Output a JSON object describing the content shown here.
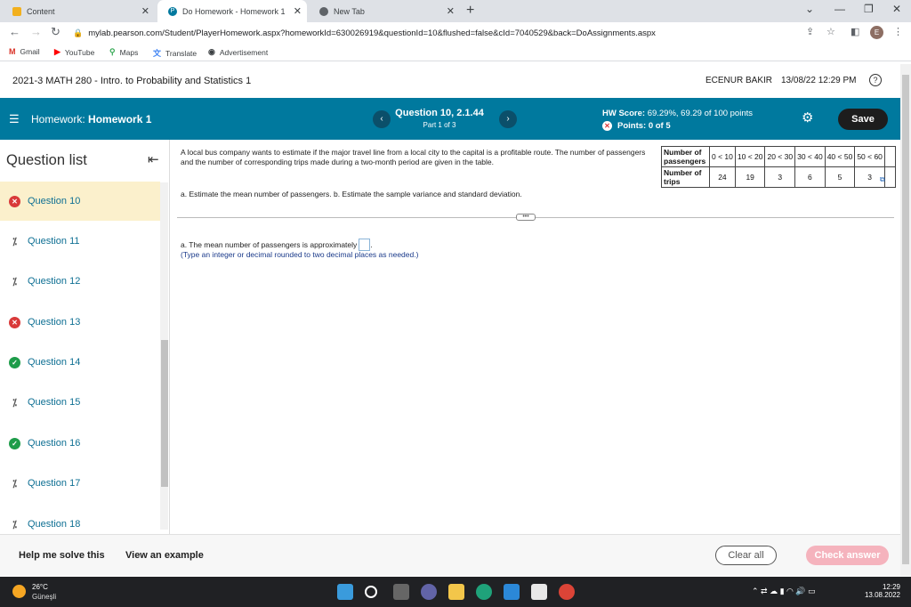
{
  "browser": {
    "tabs": [
      {
        "label": "Content",
        "active": false
      },
      {
        "label": "Do Homework - Homework 1",
        "active": true
      },
      {
        "label": "New Tab",
        "active": false
      }
    ],
    "url": "mylab.pearson.com/Student/PlayerHomework.aspx?homeworkId=630026919&questionId=10&flushed=false&cId=7040529&back=DoAssignments.aspx",
    "avatar_letter": "E",
    "bookmarks": [
      "Gmail",
      "YouTube",
      "Maps",
      "Translate",
      "Advertisement"
    ]
  },
  "course": {
    "title": "2021-3 MATH 280 - Intro. to Probability and Statistics 1",
    "user": "ECENUR BAKIR",
    "datetime": "13/08/22 12:29 PM",
    "help": "?"
  },
  "hwbar": {
    "label_prefix": "Homework:",
    "homework_name": "Homework 1",
    "question_title": "Question 10, 2.1.44",
    "part": "Part 1 of 3",
    "hw_score_label": "HW Score:",
    "hw_score_value": "69.29%, 69.29 of 100 points",
    "points": "Points: 0 of 5",
    "save_label": "Save",
    "accent": "#00799e"
  },
  "sidebar": {
    "title": "Question list",
    "items": [
      {
        "label": "Question 10",
        "status": "wrong"
      },
      {
        "label": "Question 11",
        "status": "partial"
      },
      {
        "label": "Question 12",
        "status": "partial"
      },
      {
        "label": "Question 13",
        "status": "wrong"
      },
      {
        "label": "Question 14",
        "status": "right"
      },
      {
        "label": "Question 15",
        "status": "partial"
      },
      {
        "label": "Question 16",
        "status": "right"
      },
      {
        "label": "Question 17",
        "status": "partial"
      },
      {
        "label": "Question 18",
        "status": "partial"
      }
    ]
  },
  "question": {
    "prompt": "A local bus company wants to estimate if the major travel line from a local city to the capital is a profitable route. The number of passengers and the number of corresponding trips made during a two-month period are given in the table.",
    "instructions": "a. Estimate the mean number of passengers. b. Estimate the sample variance and standard deviation.",
    "answer_prefix": "a. The mean number of passengers is approximately",
    "answer_suffix": ".",
    "hint": "(Type an integer or decimal rounded to two decimal places as needed.)",
    "table": {
      "row1_header": "Number of passengers",
      "row2_header": "Number of trips",
      "classes": [
        "0 < 10",
        "10 < 20",
        "20 < 30",
        "30 < 40",
        "40 < 50",
        "50 < 60"
      ],
      "trips": [
        "24",
        "19",
        "3",
        "6",
        "5",
        "3"
      ]
    }
  },
  "actions": {
    "help": "Help me solve this",
    "example": "View an example",
    "clear": "Clear all",
    "check": "Check answer"
  },
  "taskbar": {
    "temperature": "26°C",
    "condition": "Güneşli",
    "time": "12:29",
    "date": "13.08.2022"
  }
}
